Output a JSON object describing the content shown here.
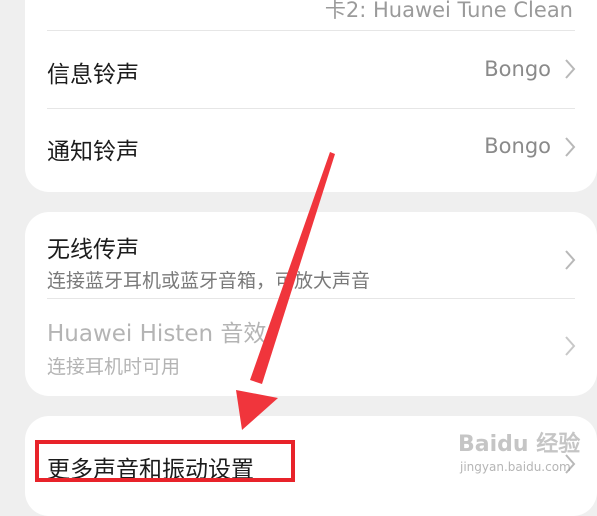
{
  "ringtone_card": {
    "partial_top_text": "卡2: Huawei Tune Clean",
    "items": [
      {
        "label": "信息铃声",
        "value": "Bongo"
      },
      {
        "label": "通知铃声",
        "value": "Bongo"
      }
    ]
  },
  "audio_card": {
    "items": [
      {
        "label": "无线传声",
        "subtitle": "连接蓝牙耳机或蓝牙音箱，可放大声音",
        "enabled": true
      },
      {
        "label": "Huawei Histen 音效",
        "subtitle": "连接耳机时可用",
        "enabled": false
      }
    ]
  },
  "more_card": {
    "label": "更多声音和振动设置"
  },
  "annotation": {
    "highlight_color": "#e8232a",
    "arrow_color": "#f0353c"
  },
  "watermark": {
    "logo_text": "Baidu 经验",
    "url": "jingyan.baidu.com"
  },
  "colors": {
    "background": "#efefef",
    "card": "#ffffff",
    "disabled_text": "#b4b4b4"
  }
}
